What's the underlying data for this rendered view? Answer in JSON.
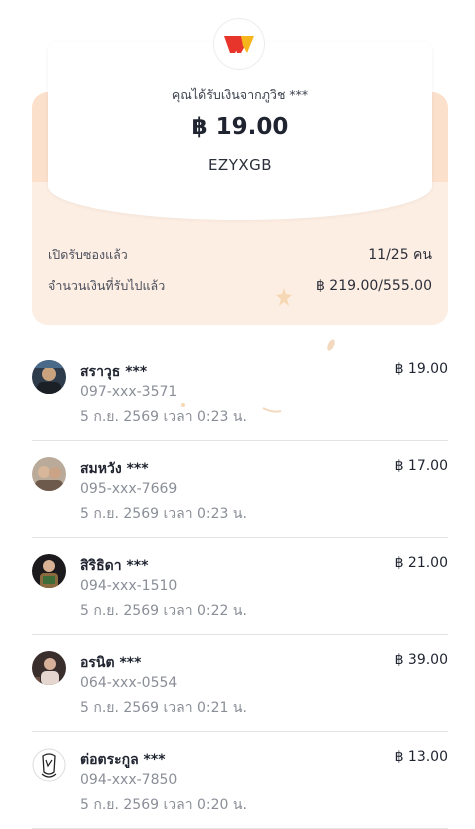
{
  "colors": {
    "accent_peach": "#fdeee3",
    "brand_red": "#e8352b",
    "brand_yellow": "#f6b51c",
    "muted_text": "#8a8e97"
  },
  "header": {
    "logo_icon": "truemoney-wallet-logo",
    "sender_text": "คุณได้รับเงินจากภูวิช ***",
    "amount": "฿ 19.00",
    "code": "EZYXGB"
  },
  "stats": {
    "opened_label": "เปิดรับซองแล้ว",
    "opened_value": "11/25 คน",
    "received_label": "จำนวนเงินที่รับไปแล้ว",
    "received_value": "฿ 219.00/555.00"
  },
  "recipients": [
    {
      "name": "สราวุธ ***",
      "amount": "฿ 19.00",
      "phone": "097-xxx-3571",
      "time": "5 ก.ย. 2569 เวลา 0:23 น."
    },
    {
      "name": "สมหวัง ***",
      "amount": "฿ 17.00",
      "phone": "095-xxx-7669",
      "time": "5 ก.ย. 2569 เวลา 0:23 น."
    },
    {
      "name": "สิริธิดา ***",
      "amount": "฿ 21.00",
      "phone": "094-xxx-1510",
      "time": "5 ก.ย. 2569 เวลา 0:22 น."
    },
    {
      "name": "อรนิต ***",
      "amount": "฿ 39.00",
      "phone": "064-xxx-0554",
      "time": "5 ก.ย. 2569 เวลา 0:21 น."
    },
    {
      "name": "ต่อตระกูล ***",
      "amount": "฿ 13.00",
      "phone": "094-xxx-7850",
      "time": "5 ก.ย. 2569 เวลา 0:20 น."
    }
  ]
}
